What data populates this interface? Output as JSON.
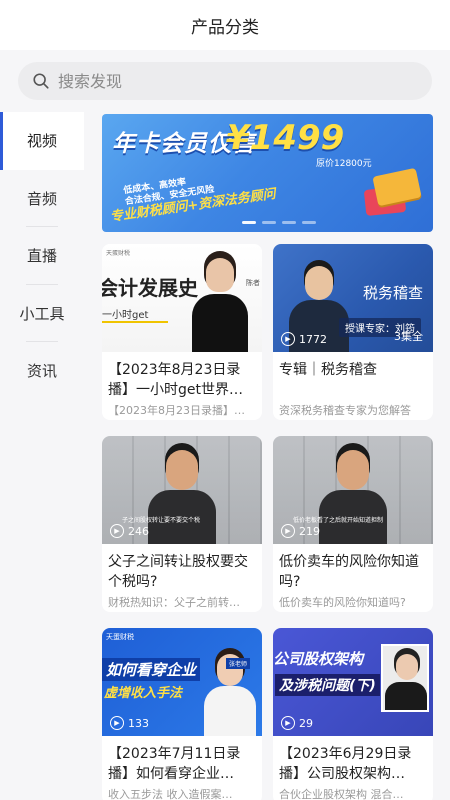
{
  "header": {
    "title": "产品分类"
  },
  "search": {
    "placeholder": "搜索发现"
  },
  "sidebar": {
    "items": [
      {
        "label": "视频",
        "active": true
      },
      {
        "label": "音频",
        "active": false
      },
      {
        "label": "直播",
        "active": false
      },
      {
        "label": "小工具",
        "active": false
      },
      {
        "label": "资讯",
        "active": false
      }
    ]
  },
  "banner": {
    "title": "年卡会员仅售",
    "price": "¥1499",
    "original": "原价12800元",
    "tags": [
      "低成本、高效率",
      "合法合规、安全无风险"
    ],
    "slogan": "专业财税顾问+资深法务顾问"
  },
  "cards": [
    {
      "thumb_big": "会计发展史",
      "thumb_small": "一小时get",
      "thumb_tag": "陈者",
      "count": "",
      "eps": "",
      "title": "【2023年8月23日录播】一小时get世界…",
      "subtitle": "【2023年8月23日录播】…"
    },
    {
      "thumb_title": "税务稽查",
      "thumb_expert": "授课专家：刘筠",
      "count": "1772",
      "eps": "3集全",
      "title": "专辑｜税务稽查",
      "subtitle": "资深税务稽查专家为您解答"
    },
    {
      "count": "246",
      "thumb_caption": "子之间股权转让要不要交个税",
      "title": "父子之间转让股权要交个税吗?",
      "subtitle": "财税热知识：父子之前转…"
    },
    {
      "count": "219",
      "thumb_caption": "低价老板看了之后就开始知道担制",
      "title": "低价卖车的风险你知道吗?",
      "subtitle": "低价卖车的风险你知道吗?"
    },
    {
      "thumb_brand": "天蛋财税",
      "thumb_l1": "如何看穿企业",
      "thumb_l2": "虚增收入手法",
      "thumb_name": "张老师",
      "count": "133",
      "title": "【2023年7月11日录播】如何看穿企业…",
      "subtitle": "收入五步法 收入造假案…"
    },
    {
      "thumb_l1": "公司股权架构",
      "thumb_l2": "及涉税问题(下)",
      "count": "29",
      "title": "【2023年6月29日录播】公司股权架构…",
      "subtitle": "合伙企业股权架构 混合…"
    }
  ],
  "colors": {
    "accent": "#2f5bd8",
    "background": "#f6f6f8"
  }
}
